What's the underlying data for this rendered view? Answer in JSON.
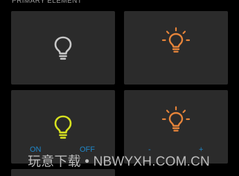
{
  "section": {
    "title": "PRIMARY ELEMENT"
  },
  "tiles": [
    {
      "icon": "lightbulb-icon",
      "state": "off",
      "color": "#c8c8c8"
    },
    {
      "icon": "lightbulb-glow-icon",
      "state": "dimmable",
      "color": "#e8853a"
    },
    {
      "icon": "lightbulb-icon",
      "state": "on",
      "color": "#d7e220",
      "on_label": "ON",
      "off_label": "OFF"
    },
    {
      "icon": "lightbulb-glow-icon",
      "state": "dimmable",
      "color": "#e8853a",
      "minus_label": "-",
      "plus_label": "+"
    }
  ],
  "colors": {
    "background": "#000000",
    "tile": "#2b2b2b",
    "accent_blue": "#1f87c9",
    "bulb_off": "#c8c8c8",
    "bulb_on": "#d7e220",
    "bulb_orange": "#e8853a"
  },
  "watermark": {
    "text": "玩意下载 • NBWYXH.COM.CN"
  }
}
